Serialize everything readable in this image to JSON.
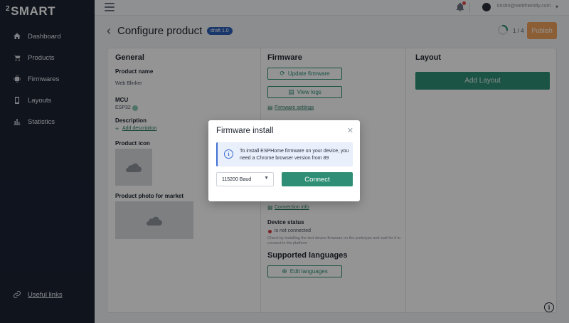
{
  "brand": {
    "logo_sup": "2",
    "logo_text": "SMART"
  },
  "sidebar": {
    "items": [
      {
        "label": "Dashboard",
        "icon": "home-icon"
      },
      {
        "label": "Products",
        "icon": "cart-icon"
      },
      {
        "label": "Firmwares",
        "icon": "chip-icon"
      },
      {
        "label": "Layouts",
        "icon": "phone-icon"
      },
      {
        "label": "Statistics",
        "icon": "bar-chart-icon"
      }
    ],
    "useful_links": "Useful links"
  },
  "topbar": {
    "user_email": "kristin@webfriendly.com"
  },
  "header": {
    "title": "Configure product",
    "badge": "draft 1.0",
    "progress_text": "1 / 4",
    "progress_fraction": 0.25,
    "publish_label": "Publish"
  },
  "general": {
    "title": "General",
    "product_name_label": "Product name",
    "product_name_value": "Web Blinker",
    "mcu_label": "MCU",
    "mcu_value": "ESP32",
    "description_label": "Description",
    "add_description": "Add description",
    "product_icon_label": "Product icon",
    "product_photo_label": "Product photo for market"
  },
  "firmware": {
    "title": "Firmware",
    "update_label": "Update firmware",
    "view_logs_label": "View logs",
    "settings_link": "Firmware settings",
    "connection_info": "Connection info",
    "device_status_label": "Device status",
    "device_status_value": "is not connected",
    "device_status_note": "Check by installing the test device firmware on the prototype and wait for it to connect to the platform",
    "supported_languages_title": "Supported languages",
    "edit_languages_label": "Edit languages"
  },
  "layout": {
    "title": "Layout",
    "add_label": "Add Layout"
  },
  "modal": {
    "title": "Firmware install",
    "info_text": "To install ESPHome firmware on your device, you need a Chrome browser version from 89",
    "baud_value": "115200 Baud",
    "connect_label": "Connect"
  },
  "colors": {
    "sidebar": "#1b2333",
    "accent": "#2f8f76",
    "publish": "#f2a35c",
    "badge": "#2b5fb7",
    "info": "#3c6fd1"
  }
}
